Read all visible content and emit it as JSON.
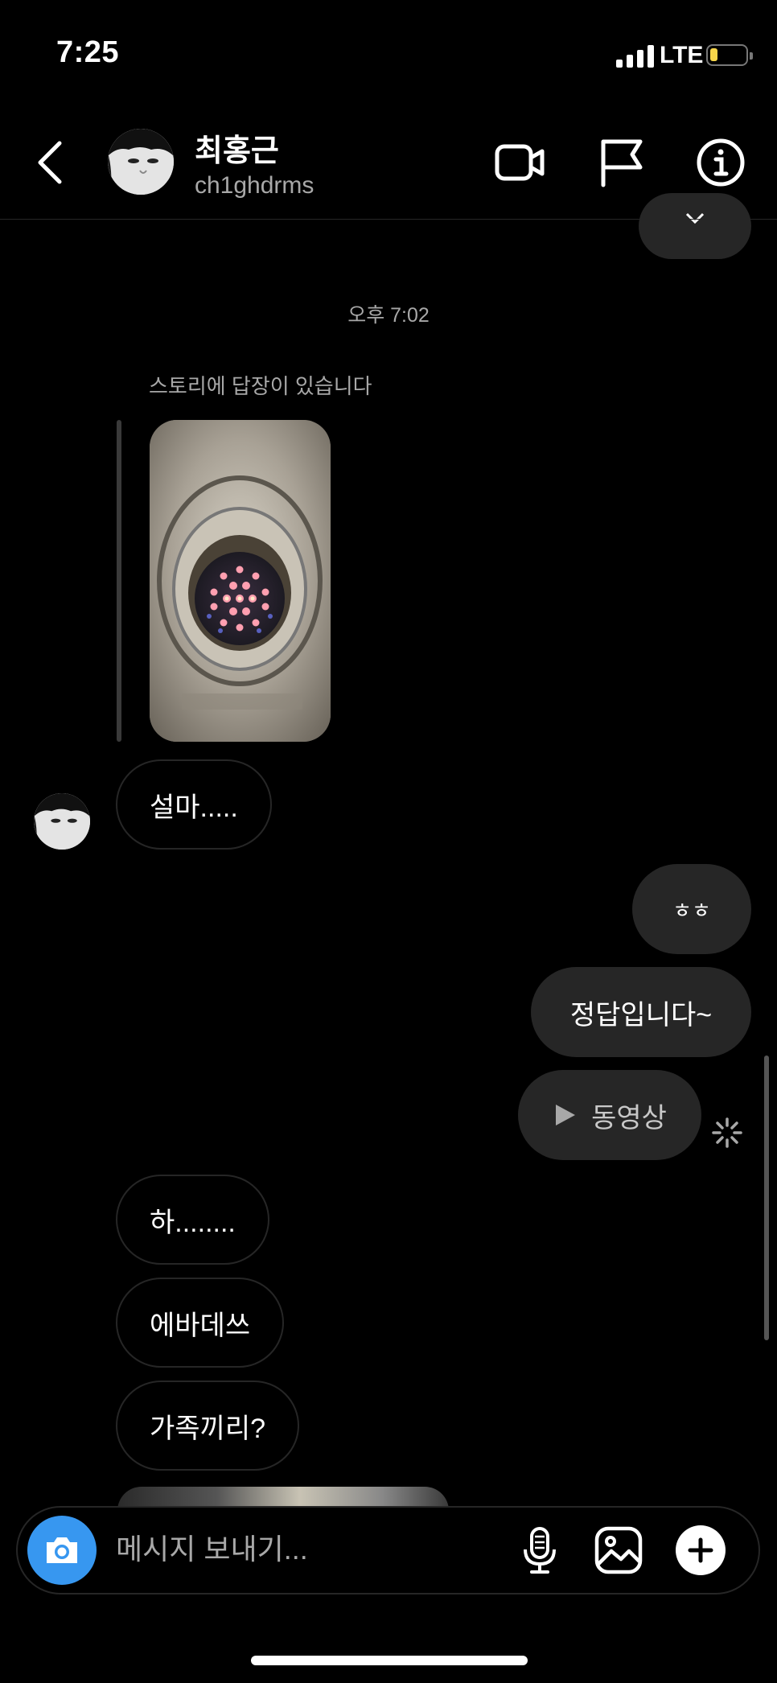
{
  "status_bar": {
    "time": "7:25",
    "network": "LTE",
    "battery_level": 0.15,
    "battery_color": "#f7d64a"
  },
  "header": {
    "name": "최홍근",
    "username": "ch1ghdrms",
    "icons": [
      "back-icon",
      "video-call-icon",
      "flag-icon",
      "info-icon"
    ]
  },
  "chat": {
    "timestamp": "오후 7:02",
    "story_reply_label": "스토리에 답장이 있습니다",
    "messages_in_1": [
      "설마....."
    ],
    "messages_out": [
      "ㅎㅎ",
      "정답입니다~"
    ],
    "video_label": "동영상",
    "messages_in_2": [
      "하........",
      "에바데쓰",
      "가족끼리?"
    ]
  },
  "composer": {
    "placeholder": "메시지 보내기...",
    "accent": "#3797f0",
    "icons": [
      "camera-icon",
      "microphone-icon",
      "gallery-icon",
      "plus-icon"
    ]
  },
  "colors": {
    "background": "#000000",
    "bubble_out": "#262626",
    "secondary_text": "#a8a8a8"
  }
}
